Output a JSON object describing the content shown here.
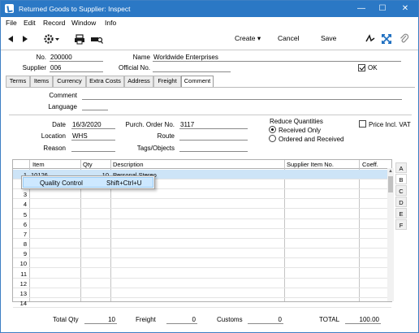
{
  "window": {
    "title": "Returned Goods to Supplier: Inspect"
  },
  "menubar": [
    "File",
    "Edit",
    "Record",
    "Window",
    "Info"
  ],
  "toolbar": {
    "create_label": "Create",
    "cancel_label": "Cancel",
    "save_label": "Save"
  },
  "header": {
    "no_label": "No.",
    "no_value": "200000",
    "name_label": "Name",
    "name_value": "Worldwide Enterprises",
    "supplier_label": "Supplier",
    "supplier_value": "006",
    "official_label": "Official No.",
    "official_value": "",
    "ok_label": "OK",
    "ok_checked": true
  },
  "tabs": [
    "Terms",
    "Items",
    "Currency",
    "Extra Costs",
    "Address",
    "Freight",
    "Comment"
  ],
  "active_tab": "Comment",
  "comment_tab": {
    "comment_label": "Comment",
    "comment_value": "",
    "language_label": "Language",
    "language_value": ""
  },
  "details": {
    "date_label": "Date",
    "date_value": "16/3/2020",
    "location_label": "Location",
    "location_value": "WHS",
    "reason_label": "Reason",
    "reason_value": "",
    "purch_label": "Purch. Order No.",
    "purch_value": "3117",
    "route_label": "Route",
    "route_value": "",
    "tags_label": "Tags/Objects",
    "tags_value": "",
    "reduce_label": "Reduce Quantities",
    "received_only_label": "Received Only",
    "ordered_received_label": "Ordered and Received",
    "reduce_selected": "Received Only",
    "price_incl_vat_label": "Price  Incl. VAT",
    "price_incl_vat_checked": false
  },
  "grid": {
    "columns": [
      "Item",
      "Qty",
      "Description",
      "Supplier Item No.",
      "Coeff."
    ],
    "rows": [
      {
        "num": "1",
        "item": "10126",
        "qty": "10",
        "description": "Personal Stereo",
        "supplier_item_no": "",
        "coeff": ""
      },
      {
        "num": "2",
        "item": "",
        "qty": "",
        "description": "",
        "supplier_item_no": "",
        "coeff": ""
      },
      {
        "num": "3",
        "item": "",
        "qty": "",
        "description": "",
        "supplier_item_no": "",
        "coeff": ""
      },
      {
        "num": "4",
        "item": "",
        "qty": "",
        "description": "",
        "supplier_item_no": "",
        "coeff": ""
      },
      {
        "num": "5",
        "item": "",
        "qty": "",
        "description": "",
        "supplier_item_no": "",
        "coeff": ""
      },
      {
        "num": "6",
        "item": "",
        "qty": "",
        "description": "",
        "supplier_item_no": "",
        "coeff": ""
      },
      {
        "num": "7",
        "item": "",
        "qty": "",
        "description": "",
        "supplier_item_no": "",
        "coeff": ""
      },
      {
        "num": "8",
        "item": "",
        "qty": "",
        "description": "",
        "supplier_item_no": "",
        "coeff": ""
      },
      {
        "num": "9",
        "item": "",
        "qty": "",
        "description": "",
        "supplier_item_no": "",
        "coeff": ""
      },
      {
        "num": "10",
        "item": "",
        "qty": "",
        "description": "",
        "supplier_item_no": "",
        "coeff": ""
      },
      {
        "num": "11",
        "item": "",
        "qty": "",
        "description": "",
        "supplier_item_no": "",
        "coeff": ""
      },
      {
        "num": "12",
        "item": "",
        "qty": "",
        "description": "",
        "supplier_item_no": "",
        "coeff": ""
      },
      {
        "num": "13",
        "item": "",
        "qty": "",
        "description": "",
        "supplier_item_no": "",
        "coeff": ""
      },
      {
        "num": "14",
        "item": "",
        "qty": "",
        "description": "",
        "supplier_item_no": "",
        "coeff": ""
      }
    ],
    "side_tabs": [
      "A",
      "B",
      "C",
      "D",
      "E",
      "F"
    ],
    "active_side_tab": "B"
  },
  "context_menu": {
    "label": "Quality Control",
    "shortcut": "Shift+Ctrl+U"
  },
  "footer": {
    "total_qty_label": "Total Qty",
    "total_qty_value": "10",
    "freight_label": "Freight",
    "freight_value": "0",
    "customs_label": "Customs",
    "customs_value": "0",
    "total_label": "TOTAL",
    "total_value": "100.00"
  },
  "colors": {
    "titlebar": "#2b78c5",
    "selection": "#cde4f7",
    "menu_highlight": "#cde8ff"
  }
}
